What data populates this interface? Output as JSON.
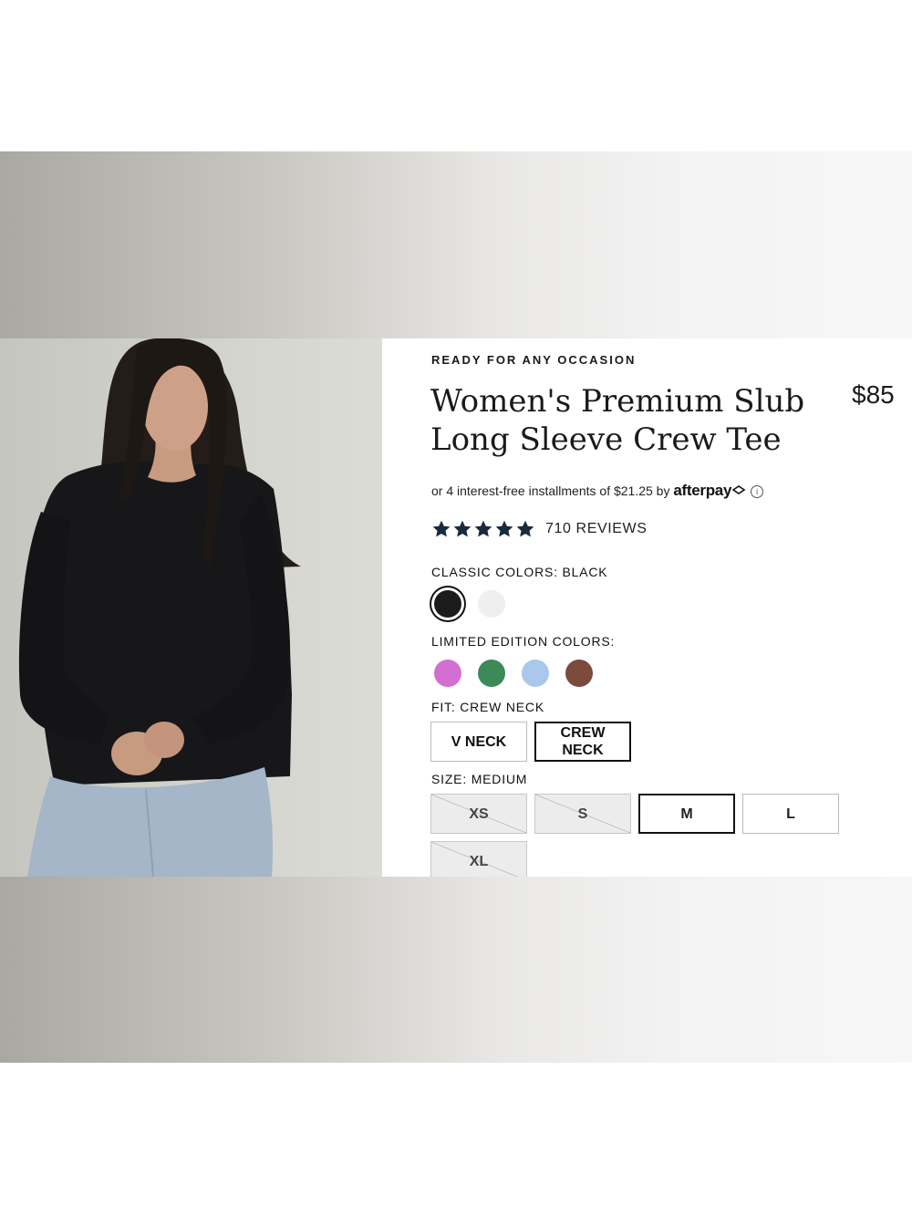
{
  "eyebrow": "READY FOR ANY OCCASION",
  "product": {
    "title_line1": "Women's Premium Slub",
    "title_line2": "Long Sleeve Crew Tee",
    "price": "$85"
  },
  "afterpay": {
    "text": "or 4 interest-free installments of $21.25 by",
    "brand": "afterpay",
    "info_glyph": "i"
  },
  "reviews": {
    "rating": 5,
    "count_label": "710 REVIEWS"
  },
  "classic_colors": {
    "label": "CLASSIC COLORS: BLACK",
    "options": [
      {
        "name": "black",
        "hex": "#1b1b1d",
        "selected": true
      },
      {
        "name": "white",
        "hex": "#efefef",
        "selected": false
      }
    ]
  },
  "limited_colors": {
    "label": "LIMITED EDITION COLORS:",
    "options": [
      {
        "name": "pink",
        "hex": "#d46ed0"
      },
      {
        "name": "green",
        "hex": "#3b8a57"
      },
      {
        "name": "light-blue",
        "hex": "#a9c8ec"
      },
      {
        "name": "brown",
        "hex": "#7a4a3a"
      }
    ]
  },
  "fit": {
    "label": "FIT: CREW NECK",
    "options": [
      {
        "label": "V NECK",
        "selected": false
      },
      {
        "label": "CREW\nNECK",
        "selected": true
      }
    ]
  },
  "size": {
    "label": "SIZE: MEDIUM",
    "options": [
      {
        "label": "XS",
        "available": false,
        "selected": false
      },
      {
        "label": "S",
        "available": false,
        "selected": false
      },
      {
        "label": "M",
        "available": true,
        "selected": true
      },
      {
        "label": "L",
        "available": true,
        "selected": false
      },
      {
        "label": "XL",
        "available": false,
        "selected": false
      }
    ]
  },
  "colors": {
    "text": "#1a1a1a",
    "star": "#1b2a3a"
  }
}
